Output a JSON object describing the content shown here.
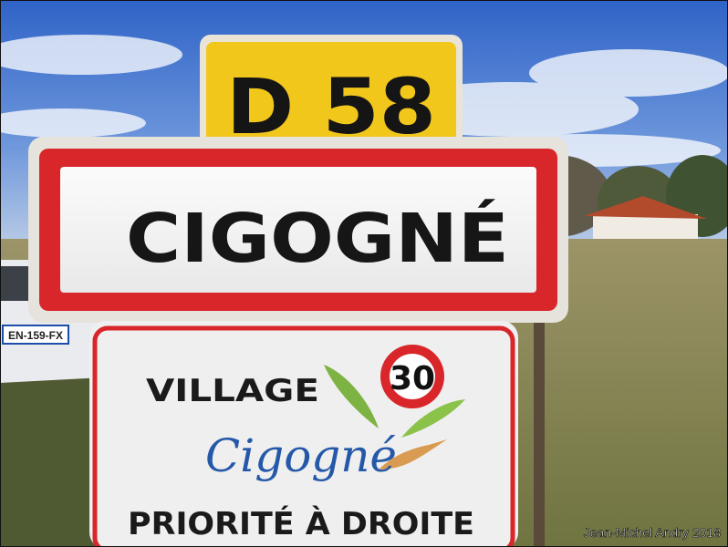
{
  "road_sign": {
    "text": "D 58",
    "color": "#f2c71c"
  },
  "town_sign": {
    "text": "CIGOGNÉ",
    "border_color": "#d8262a"
  },
  "info_sign": {
    "village": "VILLAGE",
    "speed_limit": "30",
    "logo_text": "Cigogné",
    "rule": "PRIORITÉ À DROITE"
  },
  "car": {
    "plate": "EN-159-FX"
  },
  "credit": "Jean-Michel Andry 2018",
  "colors": {
    "sky": "#3a6fd0",
    "grass": "#8d8a5a",
    "red": "#d8262a"
  }
}
